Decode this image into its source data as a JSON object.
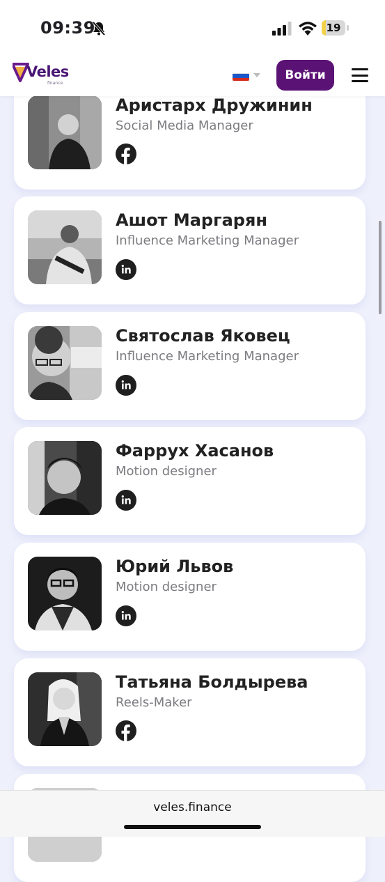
{
  "status_bar": {
    "time": "09:39",
    "battery": "19",
    "battery_level": 0.19,
    "icons": [
      "bell-slash-icon",
      "signal-icon",
      "wifi-icon",
      "battery-icon"
    ]
  },
  "header": {
    "logo_text": "Veles",
    "logo_sub": "finance",
    "language_flag": "ru-flag",
    "login_label": "Войти",
    "menu_icon": "hamburger-menu-icon",
    "brand_color": "#5b1275"
  },
  "team": [
    {
      "name": "Аристарх Дружинин",
      "role": "Social Media Manager",
      "social": "facebook"
    },
    {
      "name": "Ашот Маргарян",
      "role": "Influence Marketing Manager",
      "social": "linkedin"
    },
    {
      "name": "Святослав Яковец",
      "role": "Influence Marketing Manager",
      "social": "linkedin"
    },
    {
      "name": "Фаррух Хасанов",
      "role": "Motion designer",
      "social": "linkedin"
    },
    {
      "name": "Юрий Львов",
      "role": "Motion designer",
      "social": "linkedin"
    },
    {
      "name": "Татьяна Болдырева",
      "role": "Reels-Maker",
      "social": "facebook"
    }
  ],
  "browser": {
    "url": "veles.finance"
  }
}
